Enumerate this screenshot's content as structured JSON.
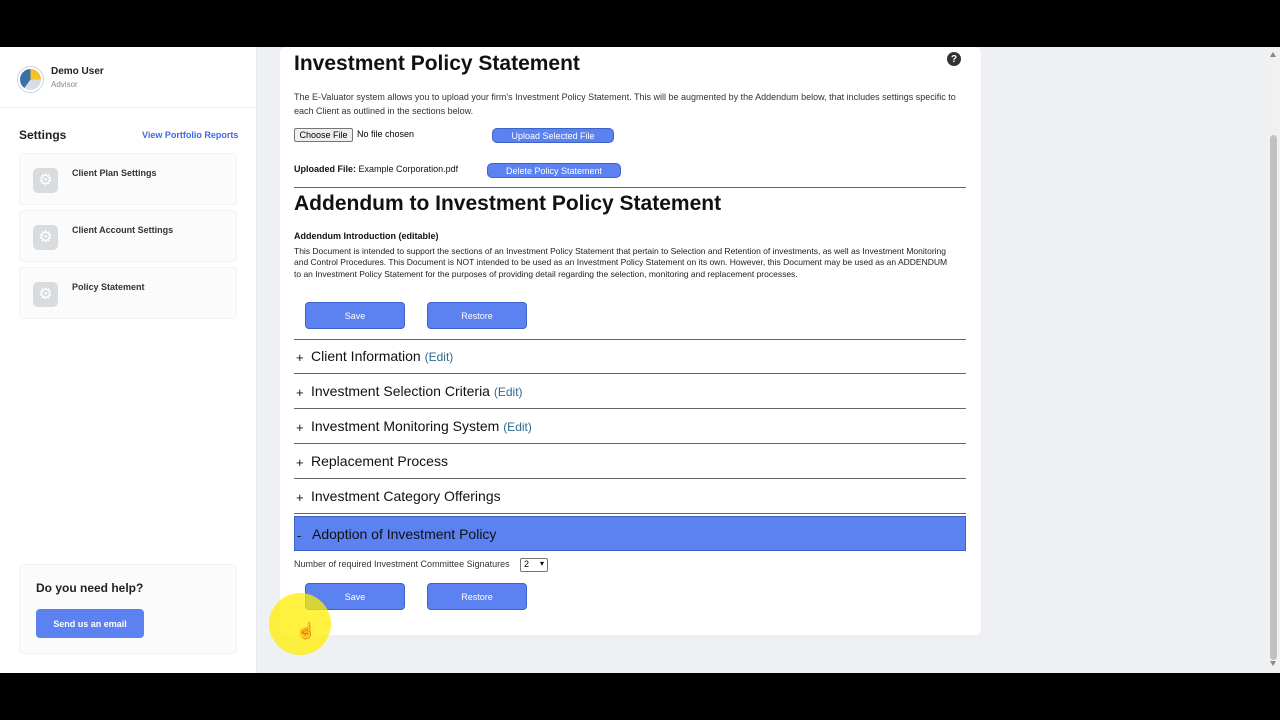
{
  "user": {
    "name": "Demo User",
    "role": "Advisor"
  },
  "sidebar": {
    "settings_title": "Settings",
    "portfolio_link": "View Portfolio Reports",
    "items": [
      {
        "label": "Client Plan Settings",
        "icon": "gear-icon"
      },
      {
        "label": "Client Account Settings",
        "icon": "gear-icon"
      },
      {
        "label": "Policy Statement",
        "icon": "gear-icon"
      }
    ],
    "help": {
      "title": "Do you need help?",
      "button": "Send us an email"
    }
  },
  "main": {
    "title": "Investment Policy Statement",
    "intro": "The E-Valuator system allows you to upload your firm's Investment Policy Statement. This will be augmented by the Addendum below, that includes settings specific to each Client as outlined in the sections below.",
    "choose_file": "Choose File",
    "no_file": "No file chosen",
    "upload_button": "Upload Selected File",
    "uploaded_label": "Uploaded File:",
    "uploaded_file": "Example Corporation.pdf",
    "delete_button": "Delete Policy Statement",
    "addendum_title": "Addendum to Investment Policy Statement",
    "addendum_label": "Addendum Introduction (editable)",
    "addendum_text": "This Document is intended to support the sections of an Investment Policy Statement that pertain to Selection and Retention of investments, as well as Investment Monitoring and Control Procedures. This Document is NOT intended to be used as an Investment Policy Statement on its own. However, this Document may be used as an ADDENDUM to an Investment Policy Statement for the purposes of providing detail regarding the selection, monitoring and replacement processes.",
    "save": "Save",
    "restore": "Restore",
    "sections": [
      {
        "sign": "+",
        "title": "Client Information",
        "edit": "(Edit)"
      },
      {
        "sign": "+",
        "title": "Investment Selection Criteria",
        "edit": "(Edit)"
      },
      {
        "sign": "+",
        "title": "Investment Monitoring System",
        "edit": "(Edit)"
      },
      {
        "sign": "+",
        "title": "Replacement Process",
        "edit": ""
      },
      {
        "sign": "+",
        "title": "Investment Category Offerings",
        "edit": ""
      },
      {
        "sign": "-",
        "title": "Adoption of Investment Policy",
        "edit": ""
      }
    ],
    "signatures_label": "Number of required Investment Committee Signatures",
    "signatures_value": "2",
    "help_icon": "?"
  },
  "colors": {
    "accent": "#5b82f0",
    "link": "#3d6ae6",
    "edit": "#2d6a8a"
  }
}
